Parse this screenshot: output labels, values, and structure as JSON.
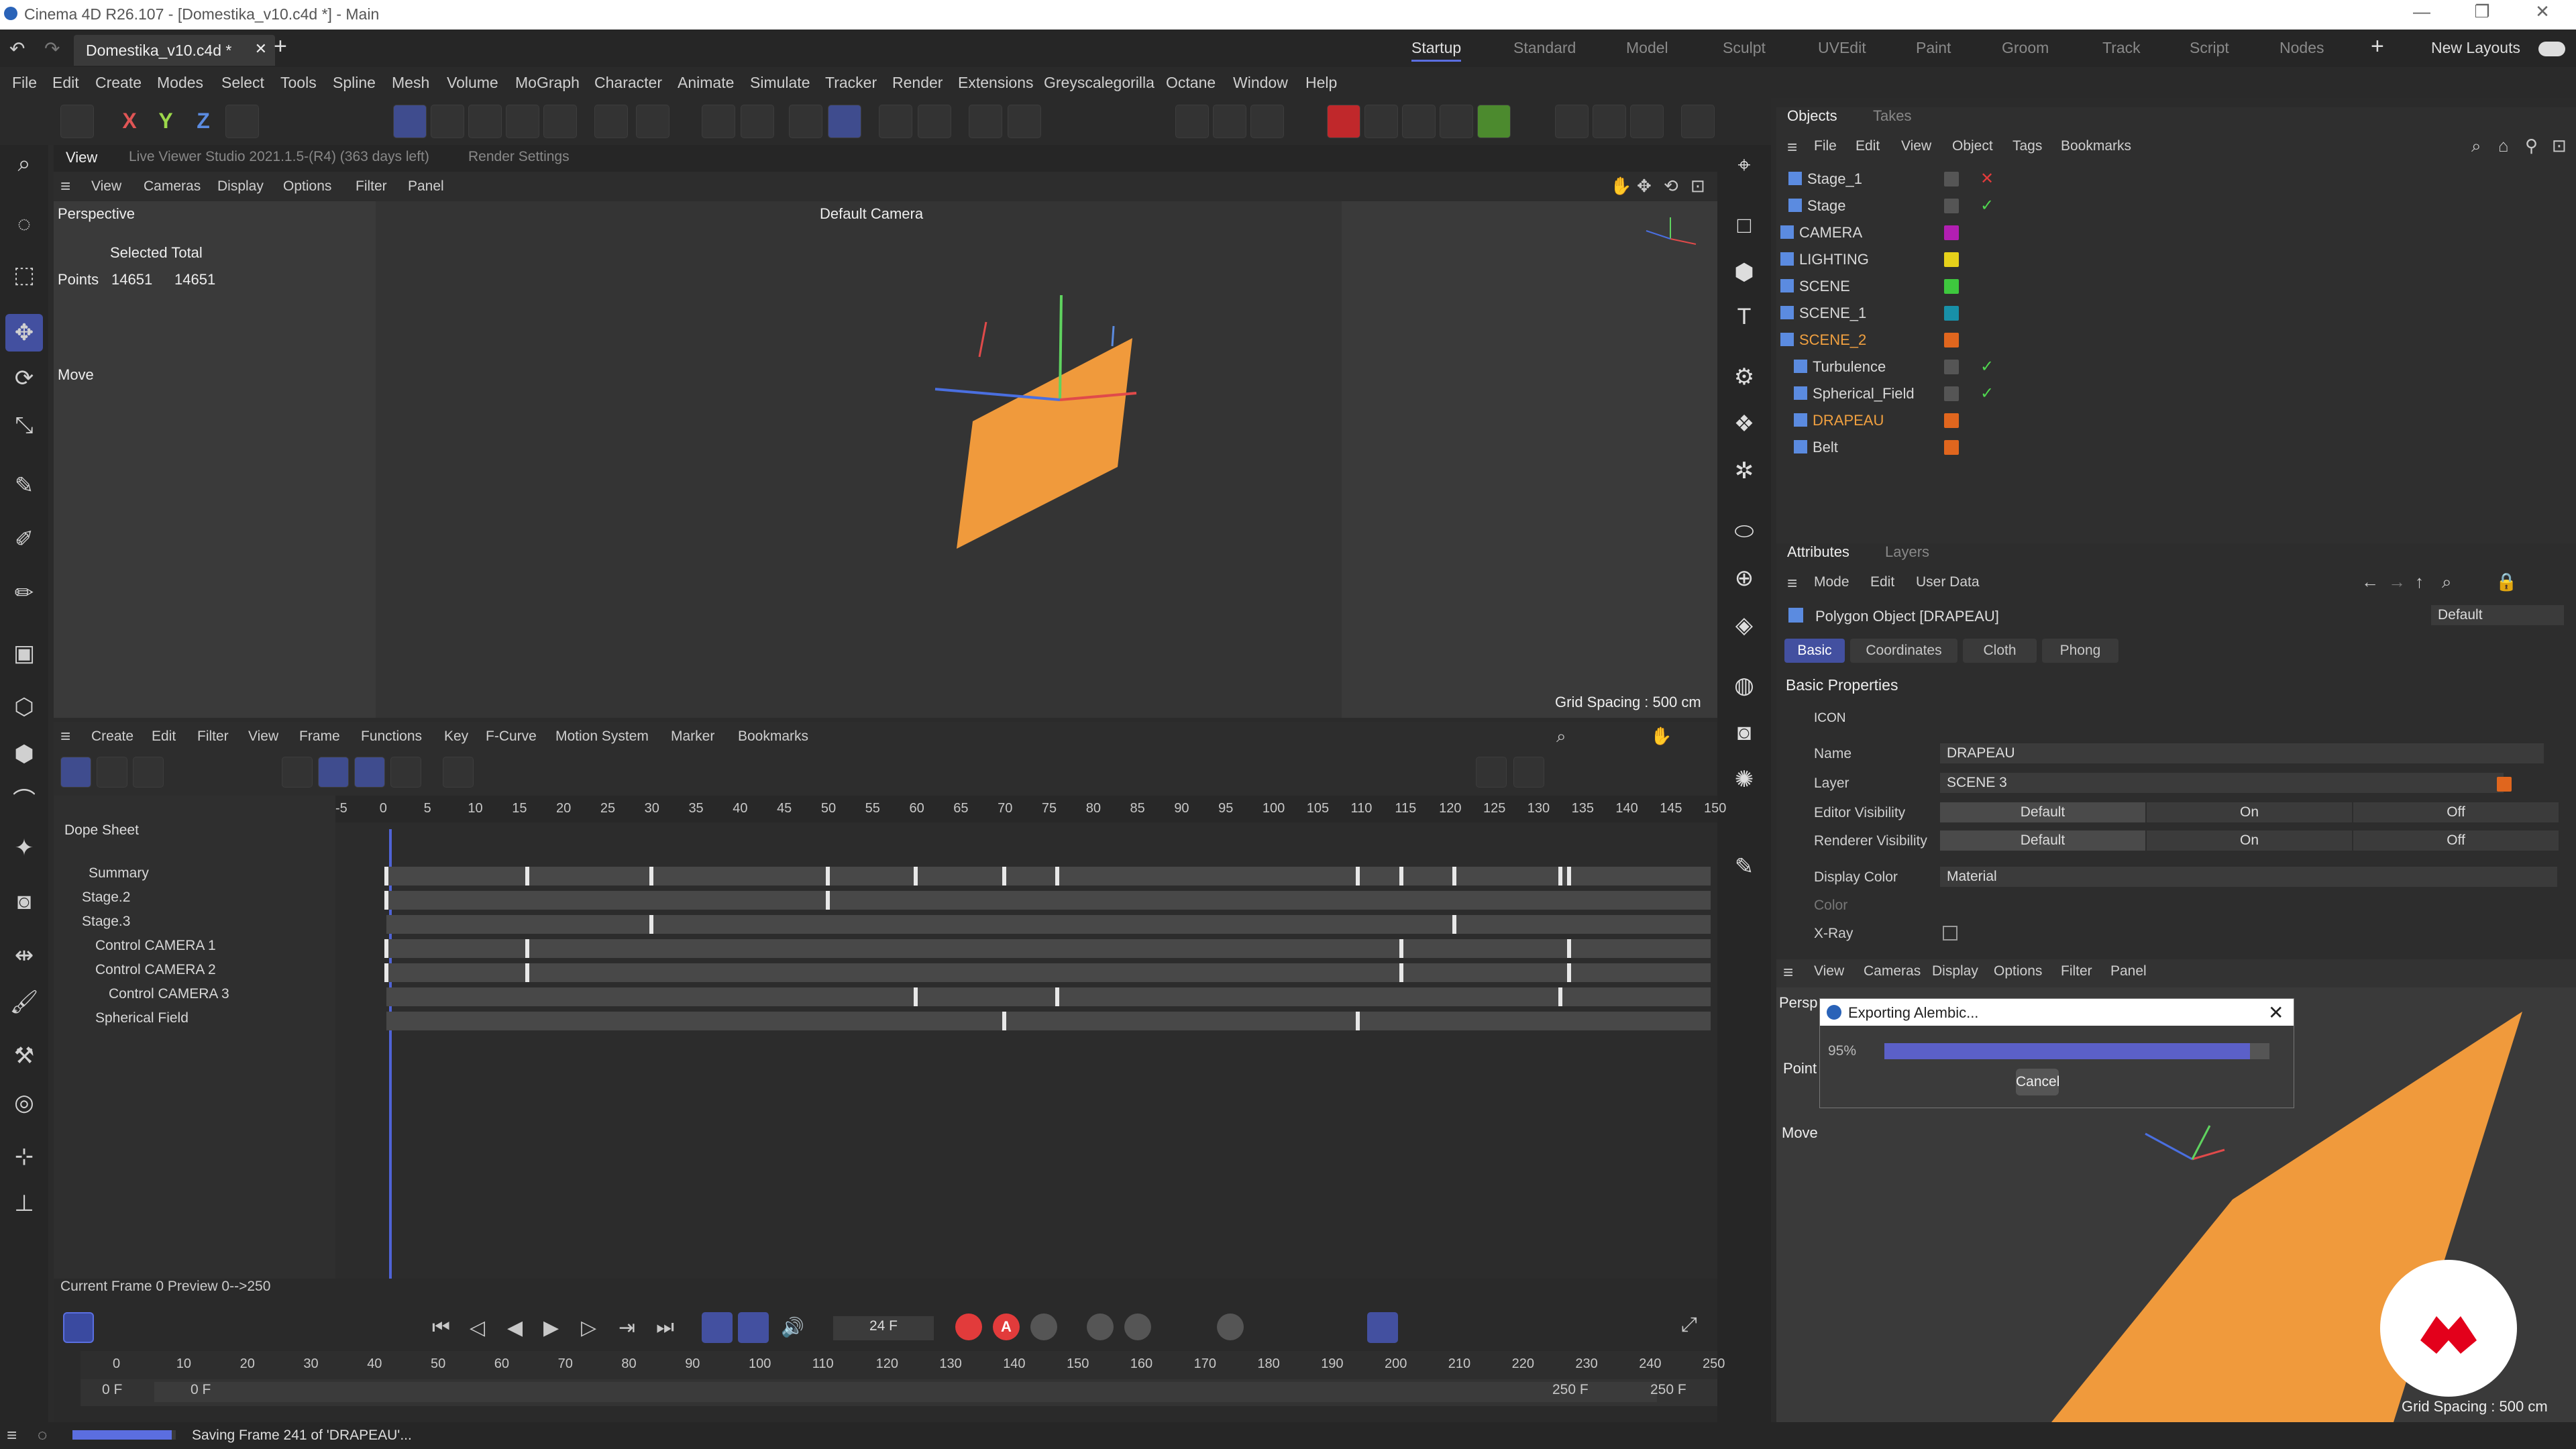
{
  "window": {
    "title": "Cinema 4D R26.107 - [Domestika_v10.c4d *] - Main"
  },
  "doc_tab": {
    "label": "Domestika_v10.c4d *"
  },
  "layouts": [
    "Startup",
    "Standard",
    "Model",
    "Sculpt",
    "UVEdit",
    "Paint",
    "Groom",
    "Track",
    "Script",
    "Nodes"
  ],
  "new_layouts": "New Layouts",
  "menu": [
    "File",
    "Edit",
    "Create",
    "Modes",
    "Select",
    "Tools",
    "Spline",
    "Mesh",
    "Volume",
    "MoGraph",
    "Character",
    "Animate",
    "Simulate",
    "Tracker",
    "Render",
    "Extensions",
    "Greyscalegorilla",
    "Octane",
    "Window",
    "Help"
  ],
  "viewport": {
    "tab": "View",
    "live_viewer": "Live Viewer Studio 2021.1.5-(R4) (363 days left)",
    "render_settings": "Render Settings",
    "menu": [
      "View",
      "Cameras",
      "Display",
      "Options",
      "Filter",
      "Panel"
    ],
    "projection": "Perspective",
    "camera": "Default Camera",
    "selected_total": "Selected Total",
    "points_label": "Points",
    "points_a": "14651",
    "points_b": "14651",
    "tool": "Move",
    "grid_spacing": "Grid Spacing : 500 cm"
  },
  "dope": {
    "menu": [
      "Create",
      "Edit",
      "Filter",
      "View",
      "Frame",
      "Functions",
      "Key",
      "F-Curve",
      "Motion System",
      "Marker",
      "Bookmarks"
    ],
    "title": "Dope Sheet",
    "ruler": [
      "-5",
      "0",
      "5",
      "10",
      "15",
      "20",
      "25",
      "30",
      "35",
      "40",
      "45",
      "50",
      "55",
      "60",
      "65",
      "70",
      "75",
      "80",
      "85",
      "90",
      "95",
      "100",
      "105",
      "110",
      "115",
      "120",
      "125",
      "130",
      "135",
      "140",
      "145",
      "150"
    ],
    "tracks": [
      {
        "name": "Summary",
        "keys": [
          0,
          16,
          30,
          50,
          60,
          70,
          76,
          110,
          115,
          121,
          133,
          134
        ]
      },
      {
        "name": "Stage.2",
        "keys": [
          0,
          50
        ]
      },
      {
        "name": "Stage.3",
        "keys": [
          30,
          121
        ]
      },
      {
        "name": "Control CAMERA 1",
        "keys": [
          0,
          16,
          115,
          134
        ]
      },
      {
        "name": "Control CAMERA 2",
        "keys": [
          0,
          16,
          115,
          134
        ]
      },
      {
        "name": "Control CAMERA 3",
        "keys": [
          60,
          76,
          133
        ]
      },
      {
        "name": "Spherical Field",
        "keys": [
          70,
          110
        ]
      }
    ],
    "status": "Current Frame  0  Preview  0-->250"
  },
  "timeline": {
    "frame_field": "24 F",
    "ruler": [
      "0",
      "10",
      "20",
      "30",
      "40",
      "50",
      "60",
      "70",
      "80",
      "90",
      "100",
      "110",
      "120",
      "130",
      "140",
      "150",
      "160",
      "170",
      "180",
      "190",
      "200",
      "210",
      "220",
      "230",
      "240",
      "250"
    ],
    "start_a": "0 F",
    "start_b": "0 F",
    "end_a": "250 F",
    "end_b": "250 F"
  },
  "status": {
    "text": "Saving Frame 241 of 'DRAPEAU'...",
    "progress": 0.96
  },
  "objects": {
    "tabs": [
      "Objects",
      "Takes"
    ],
    "menu": [
      "File",
      "Edit",
      "View",
      "Object",
      "Tags",
      "Bookmarks"
    ],
    "rows": [
      {
        "name": "Stage_1",
        "color": "#555555",
        "tag": "✕",
        "tagcolor": "#e23b3b"
      },
      {
        "name": "Stage",
        "color": "#555555",
        "tag": "✓",
        "tagcolor": "#4fd64f"
      },
      {
        "name": "CAMERA",
        "color": "#b21fb2",
        "tag": "",
        "tagcolor": ""
      },
      {
        "name": "LIGHTING",
        "color": "#e6d11a",
        "tag": "",
        "tagcolor": ""
      },
      {
        "name": "SCENE",
        "color": "#3ec83e",
        "tag": "",
        "tagcolor": ""
      },
      {
        "name": "SCENE_1",
        "color": "#1890a8",
        "tag": "",
        "tagcolor": ""
      },
      {
        "name": "SCENE_2",
        "color": "#e0661e",
        "tag": "",
        "tagcolor": ""
      },
      {
        "name": "Turbulence",
        "color": "#555555",
        "tag": "✓",
        "tagcolor": "#4fd64f"
      },
      {
        "name": "Spherical_Field",
        "color": "#555555",
        "tag": "✓",
        "tagcolor": "#4fd64f"
      },
      {
        "name": "DRAPEAU",
        "color": "#e0661e",
        "tag": "",
        "tagcolor": ""
      },
      {
        "name": "Belt",
        "color": "#e0661e",
        "tag": "",
        "tagcolor": ""
      }
    ]
  },
  "attributes": {
    "tabs": [
      "Attributes",
      "Layers"
    ],
    "menu": [
      "Mode",
      "Edit",
      "User Data"
    ],
    "object": "Polygon Object [DRAPEAU]",
    "preset": "Default",
    "subtabs": [
      "Basic",
      "Coordinates",
      "Cloth",
      "Phong"
    ],
    "section": "Basic Properties",
    "icon": "ICON",
    "name_label": "Name",
    "name_value": "DRAPEAU",
    "layer_label": "Layer",
    "layer_value": "SCENE 3",
    "ev_label": "Editor Visibility",
    "rv_label": "Renderer Visibility",
    "vis": [
      "Default",
      "On",
      "Off"
    ],
    "dc_label": "Display Color",
    "dc_value": "Material",
    "color_label": "Color",
    "xray_label": "X-Ray"
  },
  "viewport2": {
    "menu": [
      "View",
      "Cameras",
      "Display",
      "Options",
      "Filter",
      "Panel"
    ],
    "persp": "Persp",
    "point": "Point",
    "move": "Move",
    "grid": "Grid Spacing : 500 cm"
  },
  "export_dialog": {
    "title": "Exporting Alembic...",
    "percent": "95%",
    "progress": 0.95,
    "cancel": "Cancel"
  }
}
